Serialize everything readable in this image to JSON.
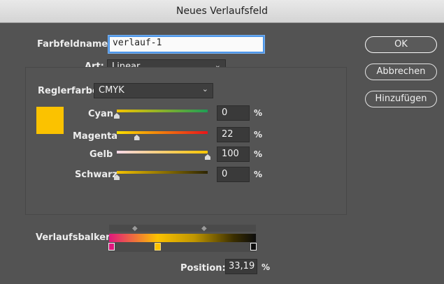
{
  "window": {
    "title": "Neues Verlaufsfeld"
  },
  "form": {
    "name_label": "Farbfeldname:",
    "name_value": "verlauf-1",
    "type_label": "Art:",
    "type_value": "Linear",
    "color_mode_label": "Reglerfarbe:",
    "color_mode_value": "CMYK"
  },
  "buttons": {
    "ok": "OK",
    "cancel": "Abbrechen",
    "add": "Hinzufügen"
  },
  "swatch_color": "#fbc200",
  "sliders": [
    {
      "label": "Cyan",
      "value": "0",
      "unit": "%",
      "fraction": 0.0
    },
    {
      "label": "Magenta",
      "value": "22",
      "unit": "%",
      "fraction": 0.22
    },
    {
      "label": "Gelb",
      "value": "100",
      "unit": "%",
      "fraction": 1.0
    },
    {
      "label": "Schwarz",
      "value": "0",
      "unit": "%",
      "fraction": 0.0
    }
  ],
  "gradient": {
    "label": "Verlaufsbalken",
    "stops": [
      {
        "color": "#e0177e",
        "position": 0
      },
      {
        "color": "#fbc200",
        "position": 33.19,
        "selected": true
      },
      {
        "color": "#0d0d0d",
        "position": 100
      }
    ],
    "position_label": "Position:",
    "position_value": "33,19",
    "position_unit": "%"
  }
}
